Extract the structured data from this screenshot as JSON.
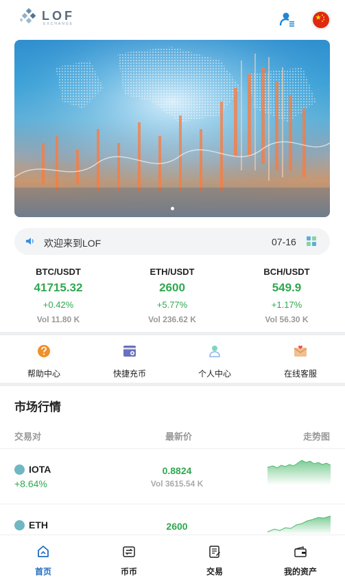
{
  "header": {
    "logo_text": "LOF",
    "logo_sub": "EXCHANGE",
    "user_icon": "user-list-icon",
    "flag_icon": "china-flag-icon"
  },
  "banner": {
    "image": "world-map-candlestick-chart-image",
    "slide_count": 1,
    "active_slide": 1
  },
  "notice": {
    "message": "欢迎来到LOF",
    "date": "07-16",
    "speaker_icon": "speaker-icon",
    "more_icon": "grid-icon"
  },
  "tickers": [
    {
      "pair": "BTC/USDT",
      "price": "41715.32",
      "change": "+0.42%",
      "vol": "Vol 11.80 K"
    },
    {
      "pair": "ETH/USDT",
      "price": "2600",
      "change": "+5.77%",
      "vol": "Vol 236.62 K"
    },
    {
      "pair": "BCH/USDT",
      "price": "549.9",
      "change": "+1.17%",
      "vol": "Vol 56.30 K"
    }
  ],
  "shortcuts": [
    {
      "label": "帮助中心",
      "icon": "help-icon"
    },
    {
      "label": "快捷充币",
      "icon": "quick-deposit-icon"
    },
    {
      "label": "个人中心",
      "icon": "profile-icon"
    },
    {
      "label": "在线客服",
      "icon": "customer-service-icon"
    }
  ],
  "market": {
    "title": "市场行情",
    "columns": {
      "pair": "交易对",
      "price": "最新价",
      "trend": "走势图"
    },
    "rows": [
      {
        "name": "IOTA",
        "change": "+8.64%",
        "price": "0.8824",
        "vol": "Vol 3615.54 K"
      },
      {
        "name": "ETH",
        "change": "",
        "price": "2600",
        "vol": ""
      }
    ]
  },
  "bottom_nav": [
    {
      "label": "首页",
      "icon": "home-icon",
      "active": true
    },
    {
      "label": "币币",
      "icon": "exchange-icon",
      "active": false
    },
    {
      "label": "交易",
      "icon": "trade-icon",
      "active": false
    },
    {
      "label": "我的资产",
      "icon": "wallet-icon",
      "active": false
    }
  ],
  "colors": {
    "accent": "#1f6ac2",
    "up": "#2fa84f",
    "muted": "#999999",
    "divider": "#eeeff1"
  }
}
